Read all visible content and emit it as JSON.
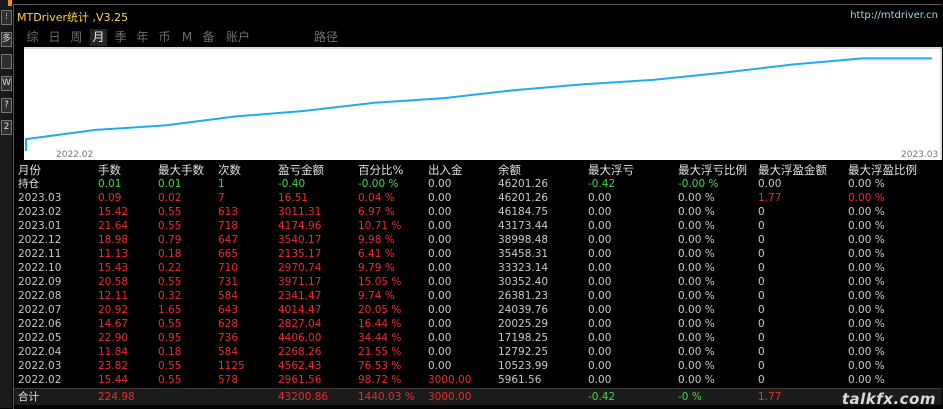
{
  "window": {
    "title": "MTDriver统计 ,V3.25",
    "link": "http://mtdriver.cn"
  },
  "left_toolbar": [
    "⁝",
    "多",
    "",
    "W",
    "?",
    "2"
  ],
  "tabs": [
    {
      "label": "综",
      "active": false
    },
    {
      "label": "日",
      "active": false
    },
    {
      "label": "周",
      "active": false
    },
    {
      "label": "月",
      "active": true
    },
    {
      "label": "季",
      "active": false
    },
    {
      "label": "年",
      "active": false
    },
    {
      "label": "币",
      "active": false
    },
    {
      "label": "M",
      "active": false
    },
    {
      "label": "备",
      "active": false
    },
    {
      "label": "账户",
      "active": false
    },
    {
      "label": "路径",
      "active": false
    }
  ],
  "chart_data": {
    "type": "line",
    "x_labels": [
      "2022.02",
      "2023.03"
    ],
    "x": [
      "2022.02",
      "2022.03",
      "2022.04",
      "2022.05",
      "2022.06",
      "2022.07",
      "2022.08",
      "2022.09",
      "2022.10",
      "2022.11",
      "2022.12",
      "2023.01",
      "2023.02",
      "2023.03"
    ],
    "values": [
      5961.56,
      10523.99,
      12792.25,
      17198.25,
      20025.29,
      24039.76,
      26381.23,
      30352.4,
      33323.14,
      35458.31,
      38998.48,
      43173.44,
      46184.75,
      46201.26
    ],
    "line_color": "#22aaee",
    "background": "#ffffff"
  },
  "table": {
    "headers": [
      "月份",
      "手数",
      "最大手数",
      "次数",
      "盈亏金额",
      "百分比%",
      "出入金",
      "余额",
      "最大浮亏",
      "最大浮亏比例",
      "最大浮盈金额",
      "最大浮盈比例"
    ],
    "holding": [
      "持仓",
      "0.01",
      "0.01",
      "1",
      "-0.40",
      "-0.00 %",
      "0.00",
      "46201.26",
      "-0.42",
      "-0.00 %",
      "0.00",
      "0.00 %"
    ],
    "rows": [
      [
        "2023.03",
        "0.09",
        "0.02",
        "7",
        "16.51",
        "0.04 %",
        "0.00",
        "46201.26",
        "0.00",
        "0.00 %",
        "1.77",
        "0.00 %"
      ],
      [
        "2023.02",
        "15.42",
        "0.55",
        "613",
        "3011.31",
        "6.97 %",
        "0.00",
        "46184.75",
        "0.00",
        "0.00 %",
        "0",
        "0.00 %"
      ],
      [
        "2023.01",
        "21.64",
        "0.55",
        "718",
        "4174.96",
        "10.71 %",
        "0.00",
        "43173.44",
        "0.00",
        "0.00 %",
        "0",
        "0.00 %"
      ],
      [
        "2022.12",
        "18.98",
        "0.79",
        "647",
        "3540.17",
        "9.98 %",
        "0.00",
        "38998.48",
        "0.00",
        "0.00 %",
        "0",
        "0.00 %"
      ],
      [
        "2022.11",
        "11.13",
        "0.18",
        "665",
        "2135.17",
        "6.41 %",
        "0.00",
        "35458.31",
        "0.00",
        "0.00 %",
        "0",
        "0.00 %"
      ],
      [
        "2022.10",
        "15.43",
        "0.22",
        "710",
        "2970.74",
        "9.79 %",
        "0.00",
        "33323.14",
        "0.00",
        "0.00 %",
        "0",
        "0.00 %"
      ],
      [
        "2022.09",
        "20.58",
        "0.55",
        "731",
        "3971.17",
        "15.05 %",
        "0.00",
        "30352.40",
        "0.00",
        "0.00 %",
        "0",
        "0.00 %"
      ],
      [
        "2022.08",
        "12.11",
        "0.32",
        "584",
        "2341.47",
        "9.74 %",
        "0.00",
        "26381.23",
        "0.00",
        "0.00 %",
        "0",
        "0.00 %"
      ],
      [
        "2022.07",
        "20.92",
        "1.65",
        "643",
        "4014.47",
        "20.05 %",
        "0.00",
        "24039.76",
        "0.00",
        "0.00 %",
        "0",
        "0.00 %"
      ],
      [
        "2022.06",
        "14.67",
        "0.55",
        "628",
        "2827.04",
        "16.44 %",
        "0.00",
        "20025.29",
        "0.00",
        "0.00 %",
        "0",
        "0.00 %"
      ],
      [
        "2022.05",
        "22.90",
        "0.95",
        "736",
        "4406.00",
        "34.44 %",
        "0.00",
        "17198.25",
        "0.00",
        "0.00 %",
        "0",
        "0.00 %"
      ],
      [
        "2022.04",
        "11.84",
        "0.18",
        "584",
        "2268.26",
        "21.55 %",
        "0.00",
        "12792.25",
        "0.00",
        "0.00 %",
        "0",
        "0.00 %"
      ],
      [
        "2022.03",
        "23.82",
        "0.55",
        "1125",
        "4562.43",
        "76.53 %",
        "0.00",
        "10523.99",
        "0.00",
        "0.00 %",
        "0",
        "0.00 %"
      ],
      [
        "2022.02",
        "15.44",
        "0.55",
        "578",
        "2961.56",
        "98.72 %",
        "3000.00",
        "5961.56",
        "0.00",
        "0.00 %",
        "0",
        "0.00 %"
      ]
    ],
    "total": [
      "合计",
      "224.98",
      "",
      "",
      "43200.86",
      "1440.03 %",
      "3000.00",
      "",
      "-0.42",
      "-0 %",
      "1.77",
      ""
    ]
  },
  "colors": {
    "header": "#e0e0e0",
    "label": "#c8c8c8",
    "green": "#3fdc3f",
    "red": "#ee2a2a",
    "white": "#e8e8e8",
    "title": "#ffd54a"
  },
  "watermark": "talkfx.com"
}
